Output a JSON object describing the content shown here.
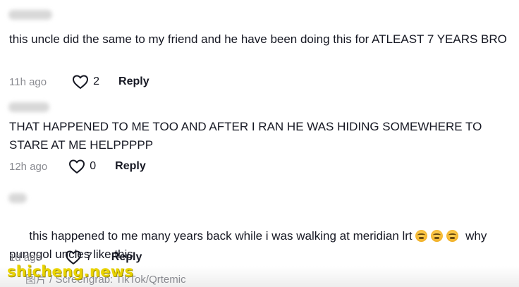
{
  "comments": [
    {
      "text": "this uncle did the same to my friend and he have been doing this for ATLEAST 7 YEARS BRO",
      "time": "11h ago",
      "likes": "2",
      "reply_label": "Reply"
    },
    {
      "text": "THAT HAPPENED TO ME TOO AND AFTER I RAN HE WAS HIDING SOMEWHERE TO STARE AT ME HELPPPPP",
      "time": "12h ago",
      "likes": "0",
      "reply_label": "Reply"
    },
    {
      "text_before_emoji": "this happened to me many years back while i was walking at meridian lrt ",
      "emojis": [
        "loudly-crying-face",
        "loudly-crying-face",
        "loudly-crying-face"
      ],
      "text_after_emoji": " why punggol uncles like this",
      "time": "1d ago",
      "likes": "7",
      "reply_label": "Reply"
    }
  ],
  "watermark": {
    "logo_text": "shicheng.news",
    "credit_text": "图片 / Screengrab: TikTok/Qrtemic"
  },
  "colors": {
    "text": "#161823",
    "muted": "#8a8b91",
    "watermark": "#e9d300"
  }
}
